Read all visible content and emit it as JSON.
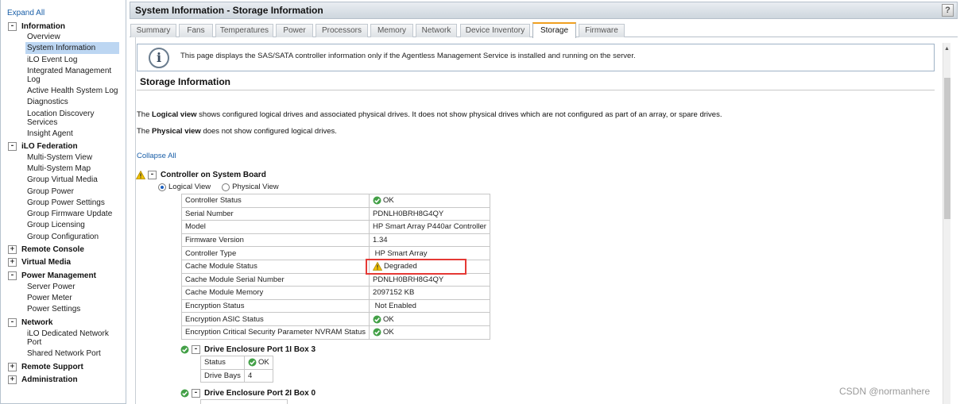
{
  "nav": {
    "expand_all": "Expand All",
    "groups": [
      {
        "label": "Information",
        "toggle": "-",
        "items": [
          "Overview",
          "System Information",
          "iLO Event Log",
          "Integrated Management Log",
          "Active Health System Log",
          "Diagnostics",
          "Location Discovery Services",
          "Insight Agent"
        ]
      },
      {
        "label": "iLO Federation",
        "toggle": "-",
        "items": [
          "Multi-System View",
          "Multi-System Map",
          "Group Virtual Media",
          "Group Power",
          "Group Power Settings",
          "Group Firmware Update",
          "Group Licensing",
          "Group Configuration"
        ]
      },
      {
        "label": "Remote Console",
        "toggle": "+"
      },
      {
        "label": "Virtual Media",
        "toggle": "+"
      },
      {
        "label": "Power Management",
        "toggle": "-",
        "items": [
          "Server Power",
          "Power Meter",
          "Power Settings"
        ]
      },
      {
        "label": "Network",
        "toggle": "-",
        "items": [
          "iLO Dedicated Network Port",
          "Shared Network Port"
        ]
      },
      {
        "label": "Remote Support",
        "toggle": "+"
      },
      {
        "label": "Administration",
        "toggle": "+"
      }
    ],
    "selected": "System Information"
  },
  "header": {
    "title": "System Information - Storage Information",
    "help": "?"
  },
  "tabs": [
    {
      "label": "Summary"
    },
    {
      "label": "Fans"
    },
    {
      "label": "Temperatures"
    },
    {
      "label": "Power"
    },
    {
      "label": "Processors"
    },
    {
      "label": "Memory"
    },
    {
      "label": "Network"
    },
    {
      "label": "Device Inventory"
    },
    {
      "label": "Storage",
      "active": true
    },
    {
      "label": "Firmware"
    }
  ],
  "info": {
    "icon": "info-icon",
    "text": "This page displays the SAS/SATA controller information only if the Agentless Management Service is installed and running on the server."
  },
  "section": {
    "heading": "Storage Information"
  },
  "paragraphs": {
    "p1_bold": "Logical view",
    "p1_pre": "The ",
    "p1_post": " shows configured logical drives and associated physical drives. It does not show physical drives which are not configured as part of an array, or spare drives.",
    "p2_pre": "The ",
    "p2_bold": "Physical view",
    "p2_post": " does not show configured logical drives."
  },
  "collapse_all": "Collapse All",
  "controller": {
    "label": "Controller on System Board",
    "status_icon": "warning-icon",
    "views": {
      "logical": "Logical View",
      "physical": "Physical View",
      "selected": "logical"
    },
    "rows": [
      {
        "label": "Controller Status",
        "value": "OK",
        "icon": "ok"
      },
      {
        "label": "Serial Number",
        "value": "PDNLH0BRH8G4QY"
      },
      {
        "label": "Model",
        "value": "HP Smart Array P440ar Controller"
      },
      {
        "label": "Firmware Version",
        "value": "1.34"
      },
      {
        "label": "Controller Type",
        "value": " HP Smart Array"
      },
      {
        "label": "Cache Module Status",
        "value": "Degraded",
        "icon": "warning",
        "highlighted": true
      },
      {
        "label": "Cache Module Serial Number",
        "value": "PDNLH0BRH8G4QY"
      },
      {
        "label": "Cache Module Memory",
        "value": "2097152 KB"
      },
      {
        "label": "Encryption Status",
        "value": " Not Enabled"
      },
      {
        "label": "Encryption ASIC Status",
        "value": "OK",
        "icon": "ok"
      },
      {
        "label": "Encryption Critical Security Parameter NVRAM Status",
        "value": "OK",
        "icon": "ok"
      }
    ]
  },
  "enclosures": [
    {
      "label": "Drive Enclosure Port 1I Box 3",
      "status_icon": "ok-icon",
      "rows": [
        {
          "label": "Status",
          "value": "OK",
          "icon": "ok"
        },
        {
          "label": "Drive Bays",
          "value": "4"
        }
      ]
    },
    {
      "label": "Drive Enclosure Port 2I Box 0",
      "status_icon": "ok-icon"
    }
  ],
  "colors": {
    "accent_tab": "#f0a020",
    "link": "#1a5fa8",
    "highlight": "#e53935",
    "ok": "#43a047",
    "warning": "#f2c200"
  },
  "watermark": "CSDN @normanhere"
}
